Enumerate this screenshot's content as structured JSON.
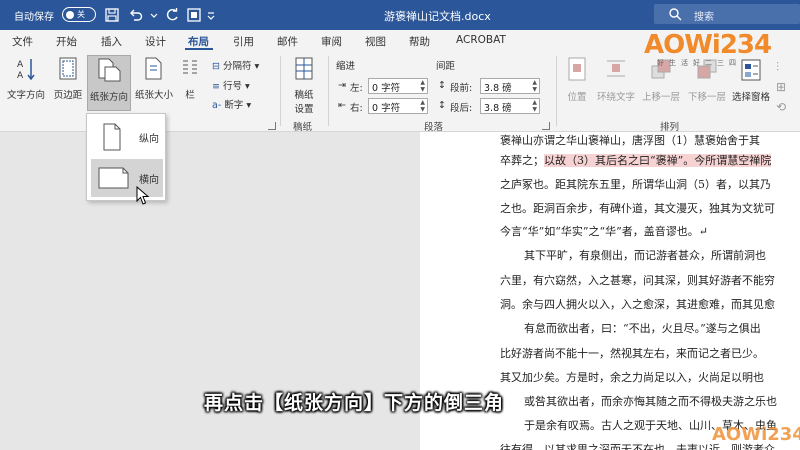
{
  "titlebar": {
    "autosave_label": "自动保存",
    "autosave_state": "关",
    "document_title": "游褒禅山记文档.docx",
    "search_placeholder": "搜索"
  },
  "tabs": [
    "文件",
    "开始",
    "插入",
    "设计",
    "布局",
    "引用",
    "邮件",
    "审阅",
    "视图",
    "帮助",
    "ACROBAT"
  ],
  "active_tab": "布局",
  "ribbon": {
    "page_setup": {
      "text_direction": "文字方向",
      "margins": "页边距",
      "orientation": "纸张方向",
      "size": "纸张大小",
      "columns": "栏",
      "breaks": "分隔符",
      "line_numbers": "行号",
      "hyphenation": "断字"
    },
    "manuscript": {
      "button": "稿纸设置",
      "group_label": "稿纸"
    },
    "paragraph": {
      "indent_title": "缩进",
      "spacing_title": "间距",
      "left_label": "左:",
      "left_value": "0 字符",
      "right_label": "右:",
      "right_value": "0 字符",
      "before_label": "段前:",
      "before_value": "3.8 磅",
      "after_label": "段后:",
      "after_value": "3.8 磅",
      "group_label": "段落"
    },
    "arrange": {
      "position": "位置",
      "wrap_text": "环绕文字",
      "bring_forward": "上移一层",
      "send_backward": "下移一层",
      "selection_pane": "选择窗格",
      "group_label": "排列"
    }
  },
  "orientation_menu": {
    "portrait": "纵向",
    "landscape": "横向"
  },
  "document_lines": [
    {
      "a": "褒禅山亦谓之华山褒禅山，唐浮图（1）慧褒始舍于其"
    },
    {
      "a": "卒葬之；",
      "hl": "以故（3）其后名之曰“褒禅”。",
      "b": "今所谓慧空禅院"
    },
    {
      "a": "之庐冢也。距其院东五里，所谓华山洞（5）者，以其乃"
    },
    {
      "a": "之也。距洞百余步，有碑仆道，其文漫灭，独其为文犹可"
    },
    {
      "a": "今言“华”如“华实”之“华”者，盖音谬也。↵"
    },
    {
      "a": "其下平旷，有泉侧出，而记游者甚众，所谓前洞也"
    },
    {
      "a": "六里，有穴窈然，入之甚寒，问其深，则其好游者不能穷"
    },
    {
      "a": "洞。余与四人拥火以入，入之愈深，其进愈难，而其见愈"
    },
    {
      "a": "有怠而欲出者，曰：“不出，火且尽。”遂与之俱出"
    },
    {
      "a": "比好游者尚不能十一，然视其左右，来而记之者已少。"
    },
    {
      "a": "其又加少矣。方是时，余之力尚足以入，火尚足以明也"
    },
    {
      "a": "或咎其欲出者，而余亦悔其随之而不得极夫游之乐也"
    },
    {
      "a": "于是余有叹焉。古人之观于天地、山川、草木、虫鱼"
    },
    {
      "a": "往有得，以其求思之深而无不在也。夫夷以近，则游者众"
    }
  ],
  "caption": "再点击【纸张方向】下方的倒三角",
  "watermark": {
    "logo": "AOWi234",
    "slogan": "好生活好二三四"
  },
  "colors": {
    "word_blue": "#2b579a",
    "ribbon_bg": "#f3f3f3",
    "highlight": "#f7d2d2"
  }
}
